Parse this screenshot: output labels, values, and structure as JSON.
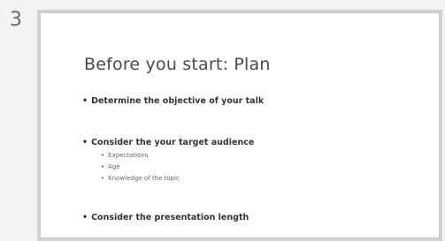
{
  "slide_number": "3",
  "slide": {
    "title": "Before you start: Plan",
    "bullets": [
      {
        "text": "Determine the objective of your talk"
      },
      {
        "text": "Consider the your target audience",
        "sub": [
          "Expectations",
          "Age",
          "Knowledge of the topic"
        ]
      },
      {
        "text": "Consider the presentation length"
      }
    ]
  }
}
